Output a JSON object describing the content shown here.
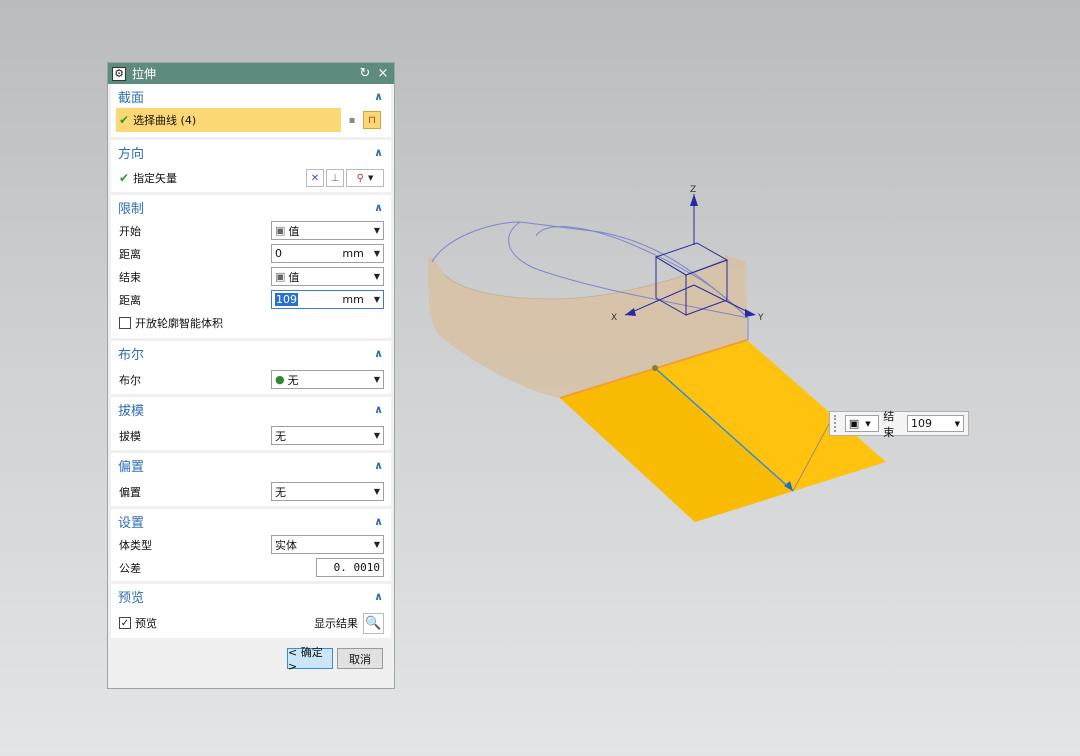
{
  "dialog": {
    "title": "拉伸",
    "reset_icon": "↻",
    "close_icon": "×",
    "sections": {
      "section": {
        "title": "截面",
        "select_label": "选择曲线 (4)"
      },
      "direction": {
        "title": "方向",
        "vector_label": "指定矢量"
      },
      "limits": {
        "title": "限制",
        "start_label": "开始",
        "start_value": "值",
        "start_dist_label": "距离",
        "start_dist_value": "0",
        "start_dist_unit": "mm",
        "end_label": "结束",
        "end_value": "值",
        "end_dist_label": "距离",
        "end_dist_value": "109",
        "end_dist_unit": "mm",
        "open_profile_label": "开放轮廓智能体积"
      },
      "boolean": {
        "title": "布尔",
        "label": "布尔",
        "value": "无"
      },
      "draft": {
        "title": "拔模",
        "label": "拔模",
        "value": "无"
      },
      "offset": {
        "title": "偏置",
        "label": "偏置",
        "value": "无"
      },
      "settings": {
        "title": "设置",
        "body_type_label": "体类型",
        "body_type_value": "实体",
        "tolerance_label": "公差",
        "tolerance_value": "0. 0010"
      },
      "preview": {
        "title": "预览",
        "preview_label": "预览",
        "show_result_label": "显示结果"
      }
    },
    "buttons": {
      "ok": "< 确定 >",
      "cancel": "取消"
    }
  },
  "float_toolbar": {
    "end_label": "结束",
    "end_value": "109"
  },
  "axes": {
    "z": "Z",
    "x": "X",
    "y": "Y"
  }
}
